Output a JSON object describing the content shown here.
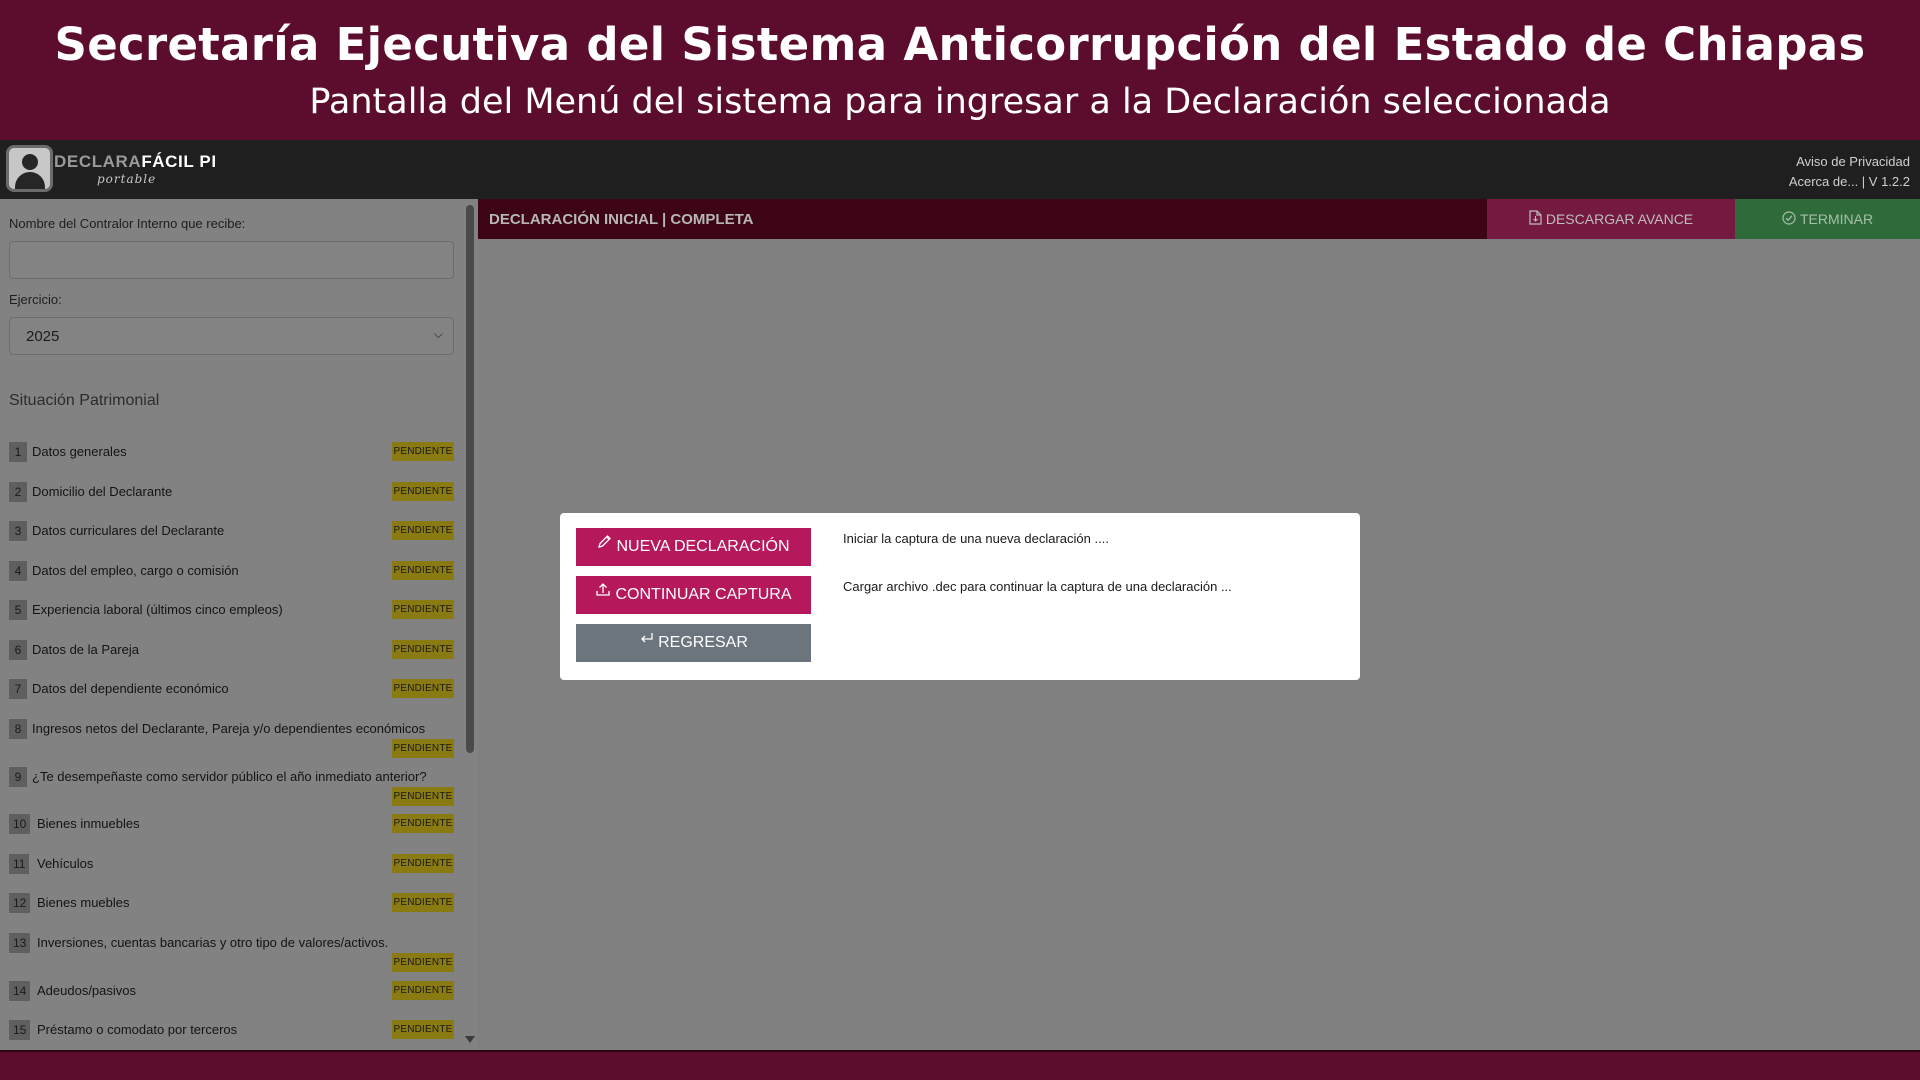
{
  "banner": {
    "title": "Secretaría Ejecutiva del Sistema Anticorrupción del Estado de Chiapas",
    "subtitle": "Pantalla del Menú del sistema para ingresar a la Declaración seleccionada"
  },
  "header": {
    "logo_part1": "DECLARA",
    "logo_part2": "FÁCIL PI",
    "logo_sub": "portable",
    "privacy_link": "Aviso de Privacidad",
    "about_link": "Acerca de... | V 1.2.2"
  },
  "sidebar": {
    "controller_label": "Nombre del Contralor Interno que recibe:",
    "controller_value": "",
    "year_label": "Ejercicio:",
    "year_value": "2025",
    "section_title": "Situación Patrimonial",
    "items": [
      {
        "num": "1",
        "label": "Datos generales",
        "status": "PENDIENTE"
      },
      {
        "num": "2",
        "label": "Domicilio del Declarante",
        "status": "PENDIENTE"
      },
      {
        "num": "3",
        "label": "Datos curriculares del Declarante",
        "status": "PENDIENTE"
      },
      {
        "num": "4",
        "label": "Datos del empleo, cargo o comisión",
        "status": "PENDIENTE"
      },
      {
        "num": "5",
        "label": "Experiencia laboral (últimos cinco empleos)",
        "status": "PENDIENTE"
      },
      {
        "num": "6",
        "label": "Datos de la Pareja",
        "status": "PENDIENTE"
      },
      {
        "num": "7",
        "label": "Datos del dependiente económico",
        "status": "PENDIENTE"
      },
      {
        "num": "8",
        "label": "Ingresos netos del Declarante, Pareja y/o dependientes económicos",
        "status": "PENDIENTE"
      },
      {
        "num": "9",
        "label": "¿Te desempeñaste como servidor público el año inmediato anterior?",
        "status": "PENDIENTE"
      },
      {
        "num": "10",
        "label": "Bienes inmuebles",
        "status": "PENDIENTE"
      },
      {
        "num": "11",
        "label": "Vehículos",
        "status": "PENDIENTE"
      },
      {
        "num": "12",
        "label": "Bienes muebles",
        "status": "PENDIENTE"
      },
      {
        "num": "13",
        "label": "Inversiones, cuentas bancarias y otro tipo de valores/activos.",
        "status": "PENDIENTE"
      },
      {
        "num": "14",
        "label": "Adeudos/pasivos",
        "status": "PENDIENTE"
      },
      {
        "num": "15",
        "label": "Préstamo o comodato por terceros",
        "status": "PENDIENTE"
      }
    ]
  },
  "main": {
    "title": "DECLARACIÓN INICIAL | COMPLETA",
    "download_label": "DESCARGAR AVANCE",
    "finish_label": "TERMINAR"
  },
  "modal": {
    "new_label": "NUEVA DECLARACIÓN",
    "new_desc": "Iniciar la captura de una nueva declaración ....",
    "continue_label": "CONTINUAR CAPTURA",
    "continue_desc": "Cargar archivo .dec para continuar la captura de una declaración ...",
    "back_label": "REGRESAR"
  },
  "colors": {
    "brand": "#5c0c2c",
    "primary_button": "#b5195c",
    "secondary_button": "#6c757d",
    "pending_badge": "#8a7a12"
  }
}
